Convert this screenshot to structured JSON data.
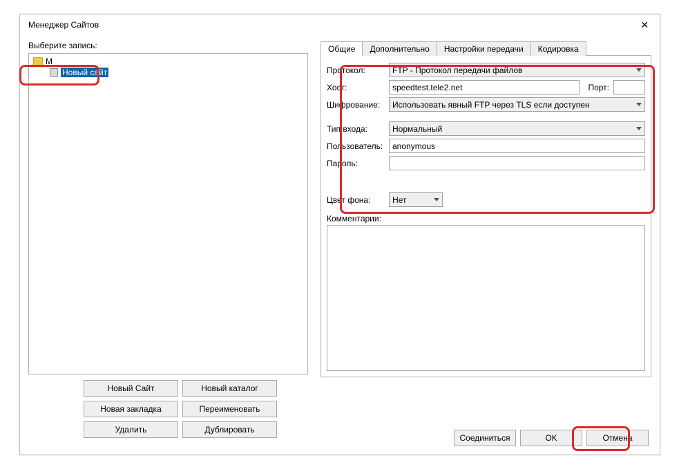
{
  "dialog": {
    "title": "Менеджер Сайтов",
    "close": "✕"
  },
  "left": {
    "select_label": "Выберите запись:",
    "tree": {
      "root_label": "М",
      "site_label": "Новый сайт"
    },
    "buttons": {
      "new_site": "Новый Сайт",
      "new_folder": "Новый каталог",
      "new_bookmark": "Новая закладка",
      "rename": "Переименовать",
      "delete": "Удалить",
      "duplicate": "Дублировать"
    }
  },
  "tabs": {
    "general": "Общие",
    "advanced": "Дополнительно",
    "transfer": "Настройки передачи",
    "charset": "Кодировка"
  },
  "form": {
    "protocol_label": "Протокол:",
    "protocol_value": "FTP - Протокол передачи файлов",
    "host_label": "Хост:",
    "host_value": "speedtest.tele2.net",
    "port_label": "Порт:",
    "port_value": "",
    "encryption_label": "Шифрование:",
    "encryption_value": "Использовать явный FTP через TLS если доступен",
    "logon_label": "Тип входа:",
    "logon_value": "Нормальный",
    "user_label": "Пользователь:",
    "user_value": "anonymous",
    "password_label": "Пароль:",
    "password_value": "",
    "bgcolor_label": "Цвет фона:",
    "bgcolor_value": "Нет",
    "comments_label": "Комментарии:"
  },
  "footer": {
    "connect": "Соединиться",
    "ok": "OK",
    "cancel": "Отмена"
  }
}
